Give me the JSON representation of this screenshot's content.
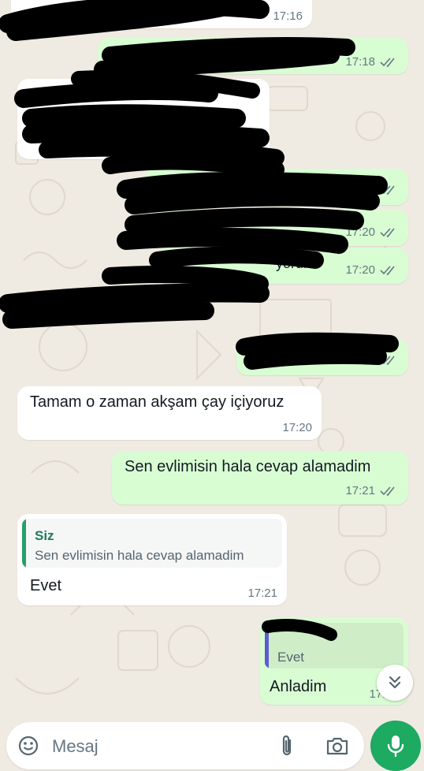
{
  "colors": {
    "background": "#efeae2",
    "incoming_bubble": "#ffffff",
    "outgoing_bubble": "#d9fdd3",
    "read_ticks": "#667781",
    "quote_self": "#1f7a5a",
    "quote_other": "#5b5bd6",
    "accent": "#1daa61"
  },
  "messages": [
    {
      "id": "m1",
      "direction": "in",
      "text": "",
      "time": "17:16",
      "redacted": true
    },
    {
      "id": "m2",
      "direction": "out",
      "text": "",
      "time": "17:18",
      "ticks": "read",
      "redacted": true
    },
    {
      "id": "m3",
      "direction": "in",
      "text": "",
      "time": "",
      "redacted": true
    },
    {
      "id": "m4",
      "direction": "out",
      "text": "",
      "time": "",
      "ticks": "read",
      "redacted": true
    },
    {
      "id": "m5",
      "direction": "out",
      "text": "",
      "time": "17:20",
      "ticks": "read",
      "redacted": true
    },
    {
      "id": "m6",
      "direction": "out",
      "text": "yorum",
      "time": "17:20",
      "ticks": "read",
      "redacted": true
    },
    {
      "id": "m7",
      "direction": "out",
      "text": "",
      "time": "",
      "ticks": "read",
      "redacted": true
    },
    {
      "id": "m8",
      "direction": "in",
      "text": "Tamam o zaman akşam çay içiyoruz",
      "time": "17:20"
    },
    {
      "id": "m9",
      "direction": "out",
      "text": "Sen evlimisin hala cevap alamadim",
      "time": "17:21",
      "ticks": "read"
    },
    {
      "id": "m10",
      "direction": "in",
      "text": "Evet",
      "time": "17:21",
      "quote": {
        "author": "Siz",
        "text": "Sen evlimisin hala cevap alamadim"
      }
    },
    {
      "id": "m11",
      "direction": "out",
      "text": "Anladim",
      "time": "17:21",
      "ticks": "read",
      "quote": {
        "author": "",
        "text": "Evet",
        "redacted_author": true
      }
    }
  ],
  "composer": {
    "placeholder": "Mesaj",
    "emoji_icon": "emoji-icon",
    "attach_icon": "paperclip-icon",
    "camera_icon": "camera-icon",
    "mic_icon": "microphone-icon"
  },
  "scroll_button_icon": "double-chevron-down-icon"
}
